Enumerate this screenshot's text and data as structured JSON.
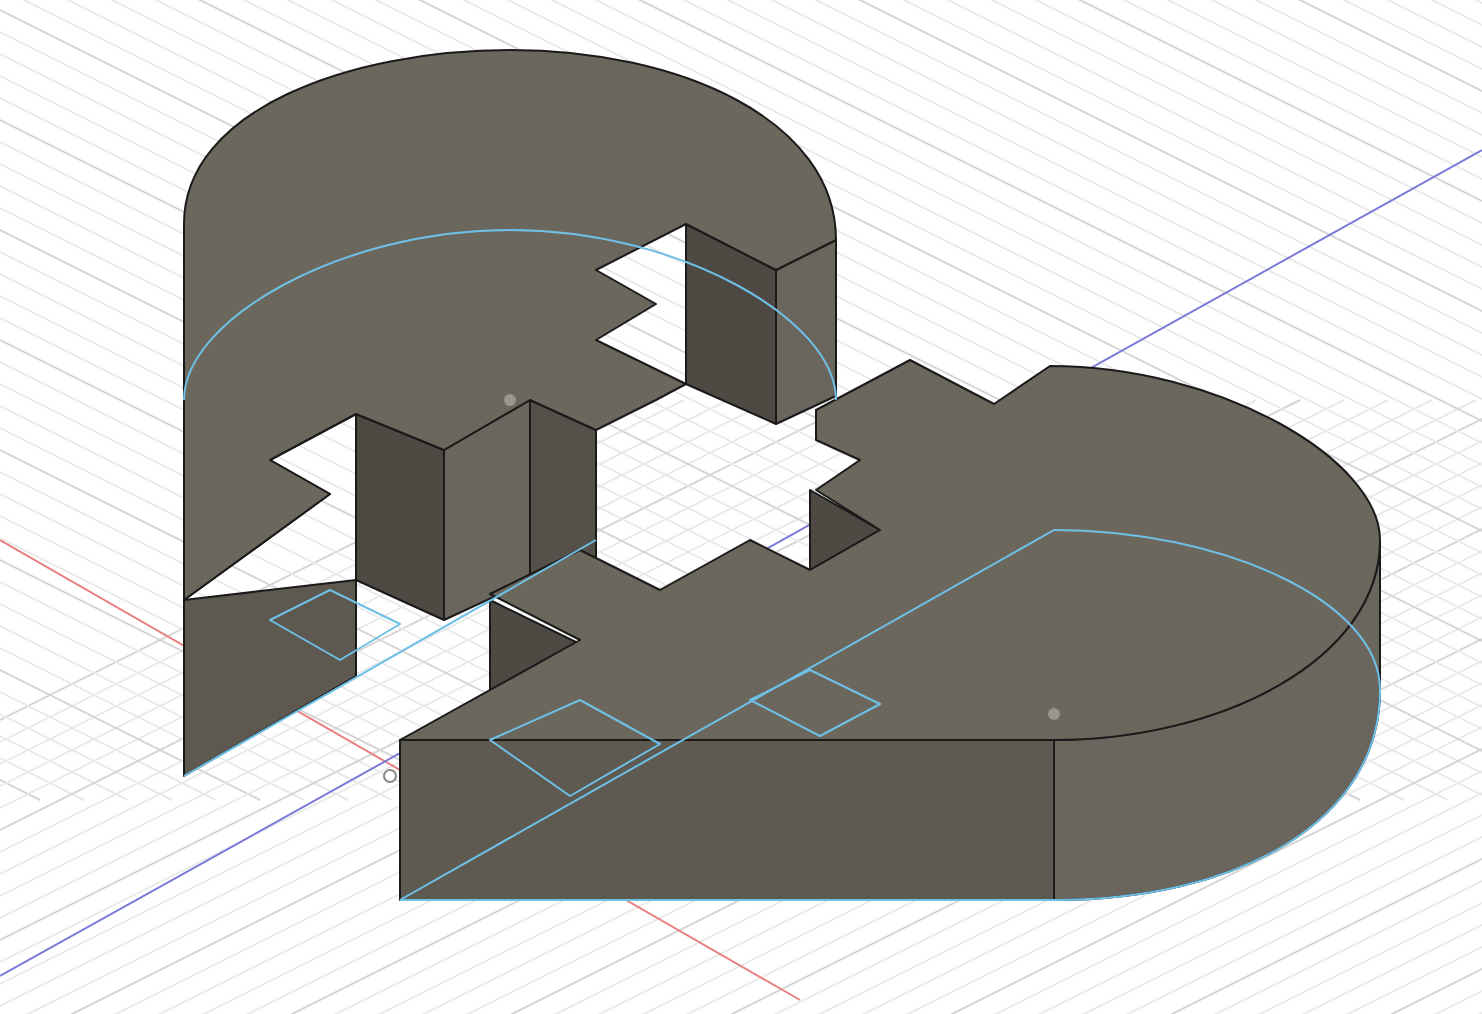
{
  "viewport": {
    "kind": "model"
  }
}
